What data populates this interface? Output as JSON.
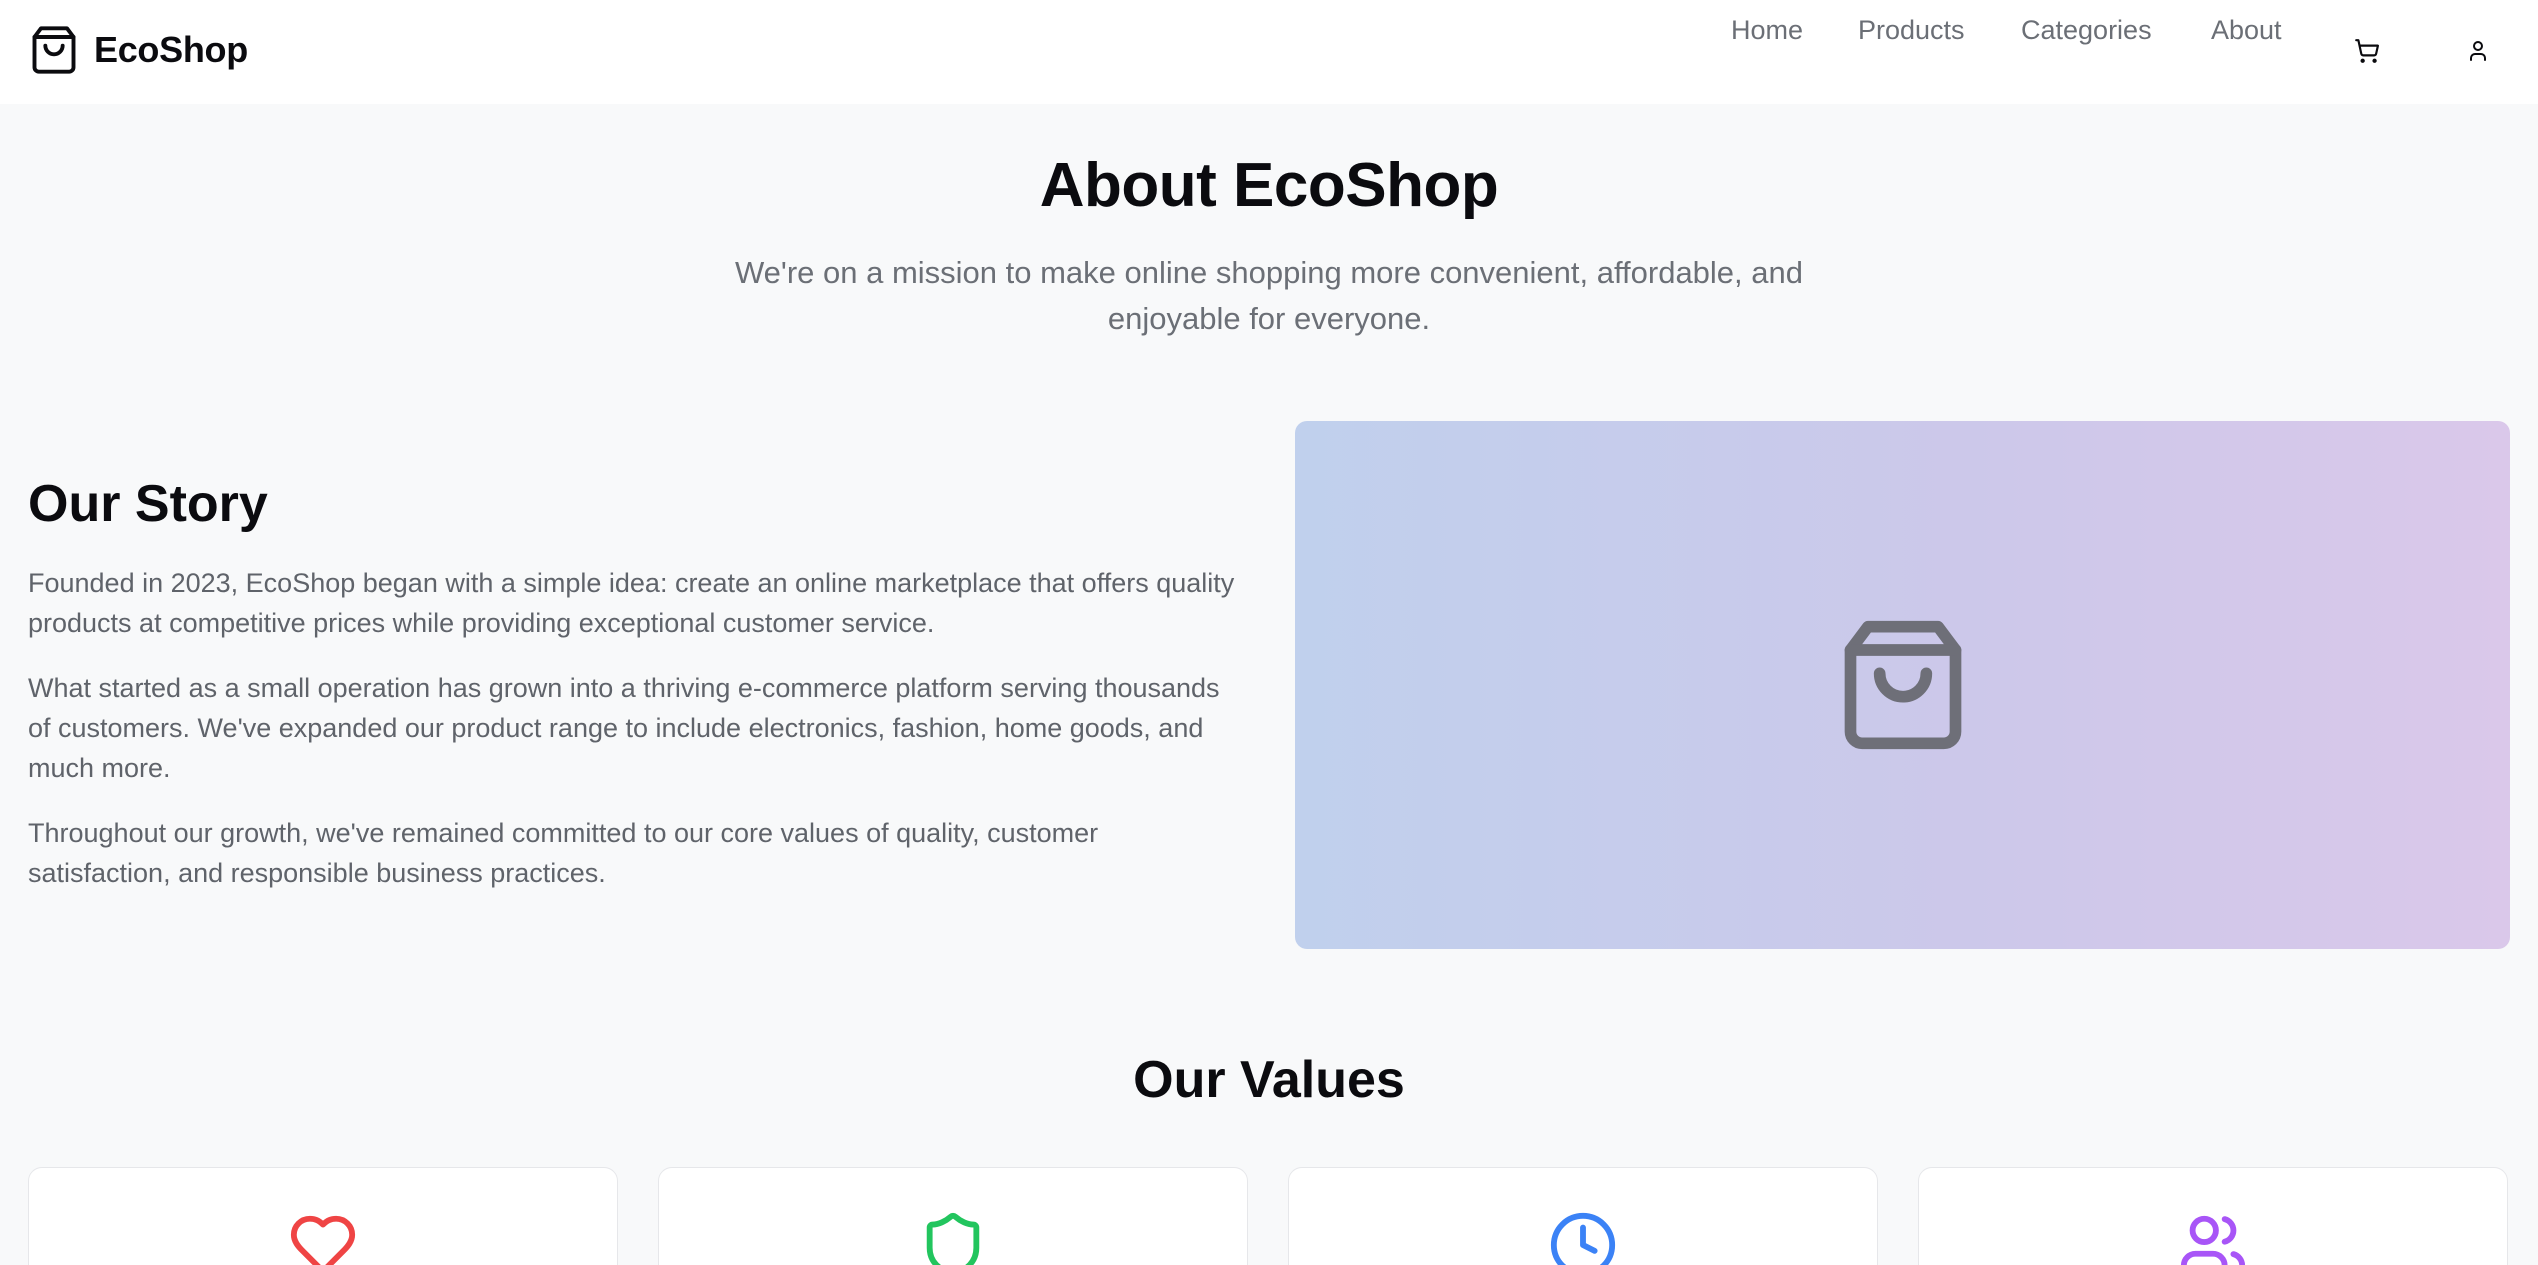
{
  "brand": {
    "name": "EcoShop",
    "icon": "shopping-bag-icon"
  },
  "nav": {
    "items": [
      {
        "label": "Home"
      },
      {
        "label": "Products"
      },
      {
        "label": "Categories"
      },
      {
        "label": "About"
      }
    ],
    "cart_icon": "cart-icon",
    "user_icon": "user-icon"
  },
  "hero": {
    "title": "About EcoShop",
    "subtitle": "We're on a mission to make online shopping more convenient, affordable, and enjoyable for everyone."
  },
  "story": {
    "title": "Our Story",
    "paragraphs": [
      "Founded in 2023, EcoShop began with a simple idea: create an online marketplace that offers quality products at competitive prices while providing exceptional customer service.",
      "What started as a small operation has grown into a thriving e-commerce platform serving thousands of customers. We've expanded our product range to include electronics, fashion, home goods, and much more.",
      "Throughout our growth, we've remained committed to our core values of quality, customer satisfaction, and responsible business practices."
    ],
    "image_icon": "shopping-bag-icon"
  },
  "values": {
    "title": "Our Values",
    "cards": [
      {
        "icon": "heart-icon",
        "color": "#ef4444"
      },
      {
        "icon": "shield-icon",
        "color": "#22c55e"
      },
      {
        "icon": "clock-icon",
        "color": "#3b82f6"
      },
      {
        "icon": "users-icon",
        "color": "#a855f7"
      }
    ]
  },
  "colors": {
    "text_primary": "#0b0b0f",
    "text_muted": "#6b6f76",
    "background": "#f8f9fa",
    "gradient_start": "#c0d0ed",
    "gradient_end": "#dac8ea"
  }
}
